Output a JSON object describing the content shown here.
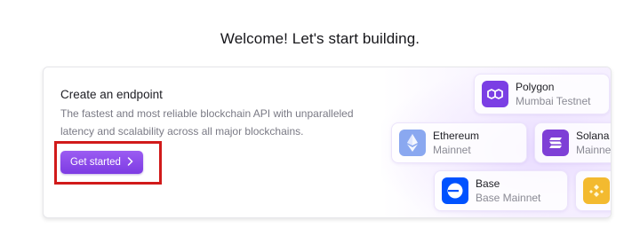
{
  "page": {
    "welcome": "Welcome! Let's start building."
  },
  "endpoint_card": {
    "title": "Create an endpoint",
    "description": "The fastest and most reliable blockchain API with unparalleled latency and scalability across all major blockchains.",
    "button_label": "Get started",
    "button_icon": "chevron-right-icon"
  },
  "chains": [
    {
      "name": "Polygon",
      "network": "Mumbai Testnet",
      "icon": "polygon-icon",
      "color": "#7b3fe4"
    },
    {
      "name": "Ethereum",
      "network": "Mainnet",
      "icon": "ethereum-icon",
      "color": "#8aa8f0"
    },
    {
      "name": "Solana",
      "network": "Mainnet",
      "icon": "solana-icon",
      "color": "#7e3fd6"
    },
    {
      "name": "Base",
      "network": "Base Mainnet",
      "icon": "base-icon",
      "color": "#0052ff"
    },
    {
      "name": "",
      "network": "",
      "icon": "bnb-icon",
      "color": "#f3ba2f"
    }
  ],
  "colors": {
    "accent": "#8a4bee",
    "highlight_box": "#d11a1a"
  }
}
